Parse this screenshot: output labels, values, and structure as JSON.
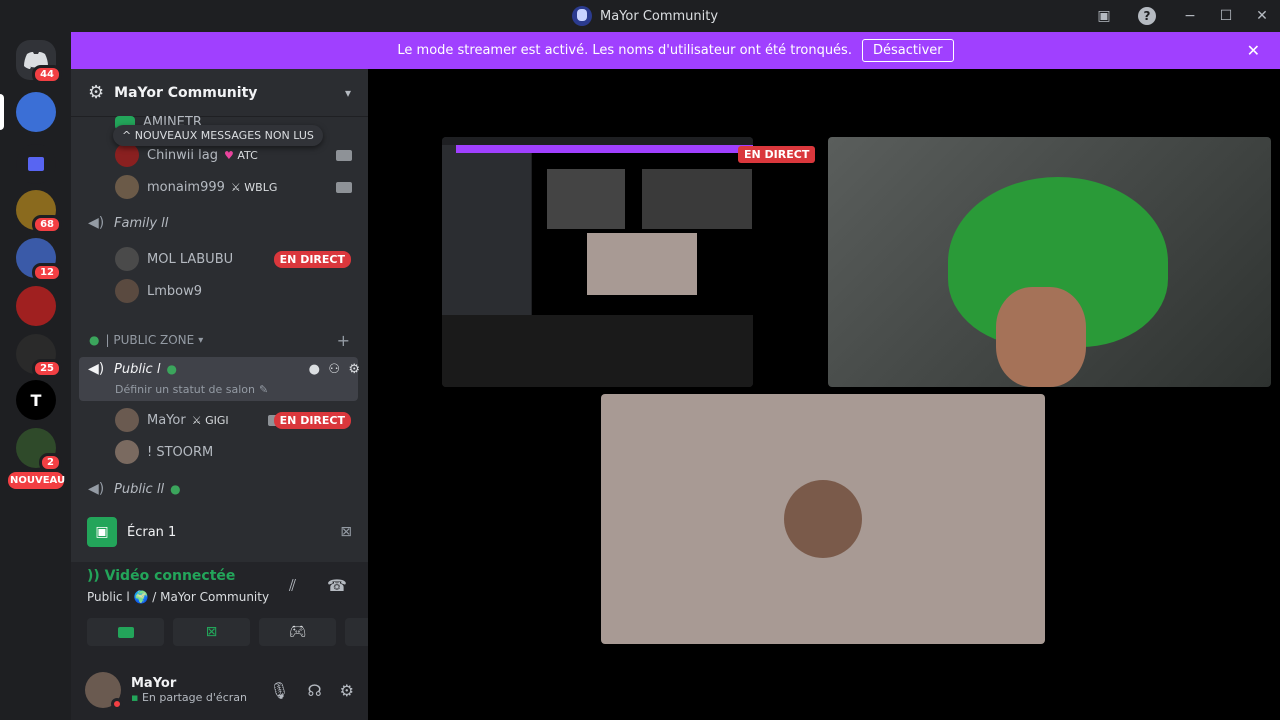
{
  "window": {
    "title": "MaYor Community",
    "controls": [
      "−",
      "☐",
      "✕"
    ]
  },
  "banner": {
    "text": "Le mode streamer est activé. Les noms d'utilisateur ont été tronqués.",
    "button": "Désactiver"
  },
  "guilds": {
    "badges": [
      "44",
      "68",
      "12",
      "25",
      "2"
    ],
    "new_label": "NOUVEAU"
  },
  "server": {
    "name": "MaYor Community"
  },
  "new_messages": "NOUVEAUX MESSAGES NON LUS",
  "members_top": [
    {
      "name": "AMINETR",
      "tag": ""
    },
    {
      "name": "Chinwii lag",
      "tag": "ATC"
    },
    {
      "name": "monaim999",
      "tag": "WBLG"
    }
  ],
  "channels": {
    "family": "Family ll",
    "family_members": [
      {
        "name": "MOL LABUBU",
        "live": "EN DIRECT"
      },
      {
        "name": "Lmbow9",
        "live": ""
      }
    ],
    "category": "| PUBLIC ZONE",
    "public1": "Public l",
    "public1_status": "Définir un statut de salon",
    "public1_members": [
      {
        "name": "MaYor",
        "tag": "GIGI",
        "live": "EN DIRECT"
      },
      {
        "name": "! STOORM",
        "tag": "",
        "live": ""
      }
    ],
    "public2": "Public ll"
  },
  "voice": {
    "screen_label": "Écran 1",
    "connected": "Vidéo connectée",
    "location": "Public l 🌍 / MaYor Community"
  },
  "user": {
    "name": "MaYor",
    "status": "En partage d'écran"
  },
  "stage": {
    "live_label": "EN DIRECT"
  }
}
